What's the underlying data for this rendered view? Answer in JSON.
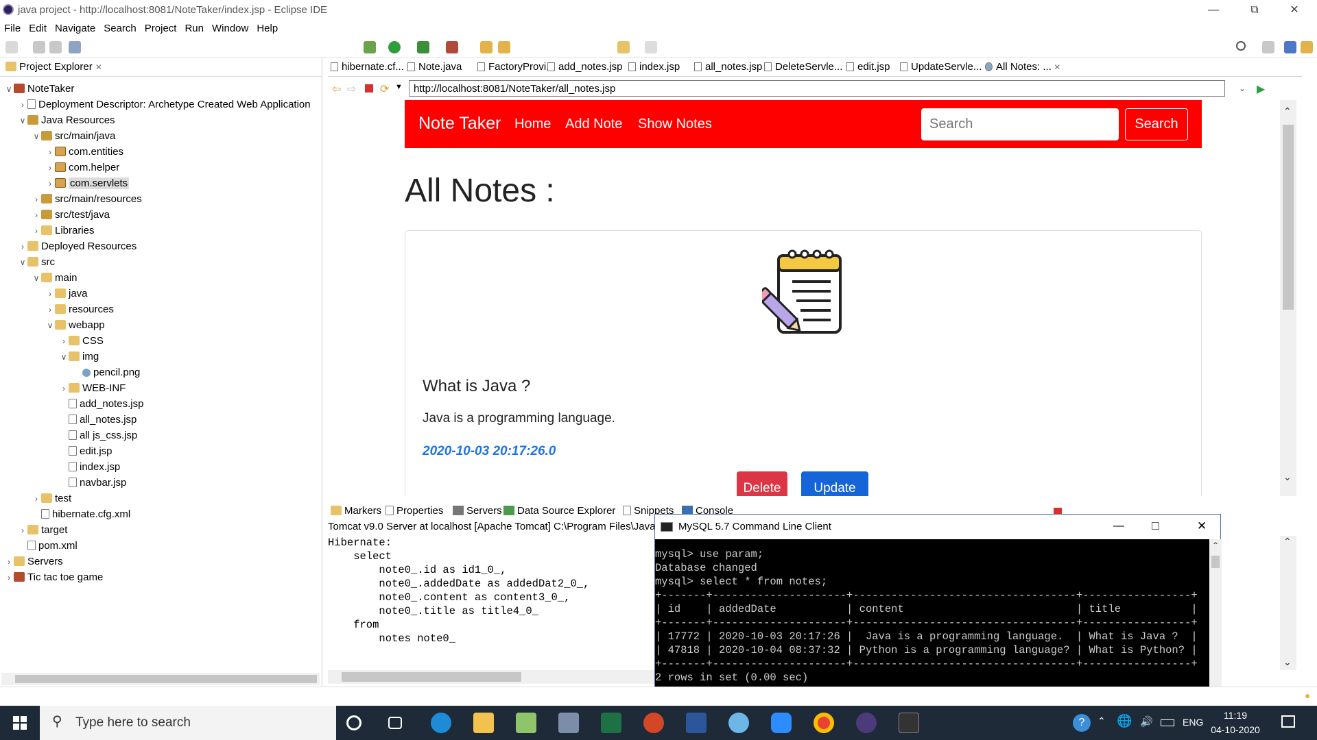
{
  "window": {
    "title": "java project - http://localhost:8081/NoteTaker/index.jsp - Eclipse IDE"
  },
  "menu": [
    "File",
    "Edit",
    "Navigate",
    "Search",
    "Project",
    "Run",
    "Window",
    "Help"
  ],
  "project_explorer": {
    "tab_label": "Project Explorer",
    "tree": [
      {
        "label": "NoteTaker",
        "indent": 0,
        "twisty": "v",
        "icon": "proj"
      },
      {
        "label": "Deployment Descriptor: Archetype Created Web Application",
        "indent": 1,
        "twisty": ">",
        "icon": "file"
      },
      {
        "label": "Java Resources",
        "indent": 1,
        "twisty": "v",
        "icon": "jfold"
      },
      {
        "label": "src/main/java",
        "indent": 2,
        "twisty": "v",
        "icon": "jfold"
      },
      {
        "label": "com.entities",
        "indent": 3,
        "twisty": ">",
        "icon": "pkg"
      },
      {
        "label": "com.helper",
        "indent": 3,
        "twisty": ">",
        "icon": "pkg"
      },
      {
        "label": "com.servlets",
        "indent": 3,
        "twisty": ">",
        "icon": "pkg",
        "selected": true
      },
      {
        "label": "src/main/resources",
        "indent": 2,
        "twisty": ">",
        "icon": "jfold"
      },
      {
        "label": "src/test/java",
        "indent": 2,
        "twisty": ">",
        "icon": "jfold"
      },
      {
        "label": "Libraries",
        "indent": 2,
        "twisty": ">",
        "icon": "fold"
      },
      {
        "label": "Deployed Resources",
        "indent": 1,
        "twisty": ">",
        "icon": "fold"
      },
      {
        "label": "src",
        "indent": 1,
        "twisty": "v",
        "icon": "fold"
      },
      {
        "label": "main",
        "indent": 2,
        "twisty": "v",
        "icon": "fold"
      },
      {
        "label": "java",
        "indent": 3,
        "twisty": ">",
        "icon": "fold"
      },
      {
        "label": "resources",
        "indent": 3,
        "twisty": ">",
        "icon": "fold"
      },
      {
        "label": "webapp",
        "indent": 3,
        "twisty": "v",
        "icon": "fold"
      },
      {
        "label": "CSS",
        "indent": 4,
        "twisty": ">",
        "icon": "fold"
      },
      {
        "label": "img",
        "indent": 4,
        "twisty": "v",
        "icon": "fold"
      },
      {
        "label": "pencil.png",
        "indent": 5,
        "twisty": "",
        "icon": "img"
      },
      {
        "label": "WEB-INF",
        "indent": 4,
        "twisty": ">",
        "icon": "fold"
      },
      {
        "label": "add_notes.jsp",
        "indent": 4,
        "twisty": "",
        "icon": "file"
      },
      {
        "label": "all_notes.jsp",
        "indent": 4,
        "twisty": "",
        "icon": "file"
      },
      {
        "label": "all js_css.jsp",
        "indent": 4,
        "twisty": "",
        "icon": "file"
      },
      {
        "label": "edit.jsp",
        "indent": 4,
        "twisty": "",
        "icon": "file"
      },
      {
        "label": "index.jsp",
        "indent": 4,
        "twisty": "",
        "icon": "file"
      },
      {
        "label": "navbar.jsp",
        "indent": 4,
        "twisty": "",
        "icon": "file"
      },
      {
        "label": "test",
        "indent": 2,
        "twisty": ">",
        "icon": "fold"
      },
      {
        "label": "hibernate.cfg.xml",
        "indent": 2,
        "twisty": "",
        "icon": "file"
      },
      {
        "label": "target",
        "indent": 1,
        "twisty": ">",
        "icon": "fold"
      },
      {
        "label": "pom.xml",
        "indent": 1,
        "twisty": "",
        "icon": "file"
      },
      {
        "label": "Servers",
        "indent": 0,
        "twisty": ">",
        "icon": "fold"
      },
      {
        "label": "Tic tac toe game",
        "indent": 0,
        "twisty": ">",
        "icon": "proj"
      }
    ]
  },
  "editor_tabs": [
    "hibernate.cf...",
    "Note.java",
    "FactoryProvi...",
    "add_notes.jsp",
    "index.jsp",
    "all_notes.jsp",
    "DeleteServle...",
    "edit.jsp",
    "UpdateServle...",
    "All Notes: ..."
  ],
  "browser": {
    "url": "http://localhost:8081/NoteTaker/all_notes.jsp",
    "navbar": {
      "brand": "Note Taker",
      "links": [
        "Home",
        "Add Note",
        "Show Notes"
      ],
      "search_placeholder": "Search",
      "search_button": "Search"
    },
    "heading": "All Notes :",
    "note": {
      "title": "What is Java ?",
      "content": "Java is a programming language.",
      "date": "2020-10-03 20:17:26.0",
      "delete_label": "Delete",
      "update_label": "Update"
    },
    "colors": {
      "navbar": "#ff0000",
      "date": "#1a73e8",
      "delete": "#dc3545",
      "update": "#1565d8"
    }
  },
  "bottom_tabs": [
    "Markers",
    "Properties",
    "Servers",
    "Data Source Explorer",
    "Snippets",
    "Console"
  ],
  "console": {
    "header": "Tomcat v9.0 Server at localhost [Apache Tomcat] C:\\Program Files\\Java\\",
    "text": "Hibernate: \n    select\n        note0_.id as id1_0_,\n        note0_.addedDate as addedDat2_0_,\n        note0_.content as content3_0_,\n        note0_.title as title4_0_ \n    from\n        notes note0_"
  },
  "mysql": {
    "title": "MySQL 5.7 Command Line Client",
    "text": "mysql> use param;\nDatabase changed\nmysql> select * from notes;\n+-------+---------------------+-----------------------------------+-----------------+\n| id    | addedDate           | content                           | title           |\n+-------+---------------------+-----------------------------------+-----------------+\n| 17772 | 2020-10-03 20:17:26 |  Java is a programming language.  | What is Java ?  |\n| 47818 | 2020-10-04 08:37:32 | Python is a programming language? | What is Python? |\n+-------+---------------------+-----------------------------------+-----------------+\n2 rows in set (0.00 sec)"
  },
  "taskbar": {
    "search_placeholder": "Type here to search",
    "time": "11:19",
    "date": "04-10-2020",
    "lang": "ENG"
  }
}
